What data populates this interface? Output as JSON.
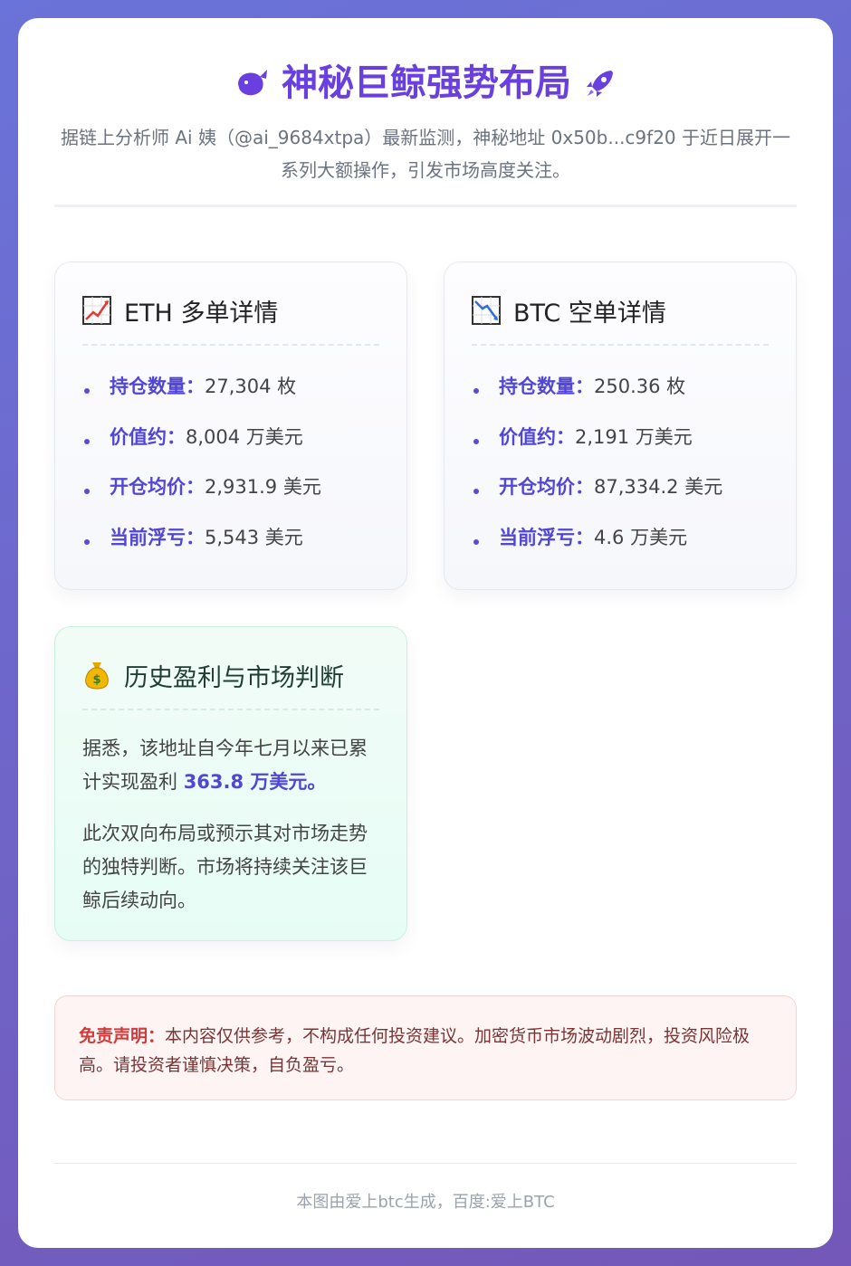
{
  "header": {
    "title": "神秘巨鲸强势布局",
    "subtitle": "据链上分析师 Ai 姨（@ai_9684xtpa）最新监测，神秘地址 0x50b...c9f20 于近日展开一系列大额操作，引发市场高度关注。"
  },
  "eth": {
    "title": "ETH 多单详情",
    "icon": "chart-increasing-icon",
    "items": [
      {
        "k": "持仓数量：",
        "v": "27,304 枚"
      },
      {
        "k": "价值约：",
        "v": "8,004 万美元"
      },
      {
        "k": "开仓均价：",
        "v": "2,931.9 美元"
      },
      {
        "k": "当前浮亏：",
        "v": "5,543 美元"
      }
    ]
  },
  "btc": {
    "title": "BTC 空单详情",
    "icon": "chart-decreasing-icon",
    "items": [
      {
        "k": "持仓数量：",
        "v": "250.36 枚"
      },
      {
        "k": "价值约：",
        "v": "2,191 万美元"
      },
      {
        "k": "开仓均价：",
        "v": "87,334.2 美元"
      },
      {
        "k": "当前浮亏：",
        "v": "4.6 万美元"
      }
    ]
  },
  "history": {
    "title": "历史盈利与市场判断",
    "icon": "money-bag-icon",
    "p1_prefix": "据悉，该地址自今年七月以来已累计实现盈利 ",
    "p1_highlight": "363.8 万美元",
    "p1_suffix": "。",
    "p2": "此次双向布局或预示其对市场走势的独特判断。市场将持续关注该巨鲸后续动向。"
  },
  "disclaimer": {
    "label": "免责声明：",
    "text": "本内容仅供参考，不构成任何投资建议。加密货币市场波动剧烈，投资风险极高。请投资者谨慎决策，自负盈亏。"
  },
  "footer": {
    "text": "本图由爱上btc生成，百度:爱上BTC"
  },
  "colors": {
    "accent": "#6a3fe0",
    "key_text": "#5146d6",
    "disclaimer_label": "#d33a3a"
  }
}
